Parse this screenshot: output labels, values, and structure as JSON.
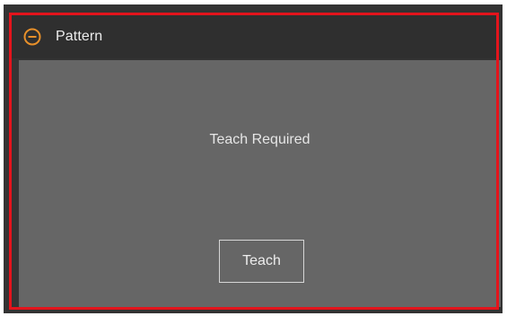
{
  "panel": {
    "title": "Pattern",
    "collapse_icon": "minus-circle-icon",
    "status_text": "Teach Required",
    "teach_button_label": "Teach"
  },
  "colors": {
    "highlight_border": "#e3141c",
    "icon_accent": "#e8902a",
    "header_bg": "#2f2f2f",
    "body_bg": "#666666",
    "text": "#ededed"
  }
}
